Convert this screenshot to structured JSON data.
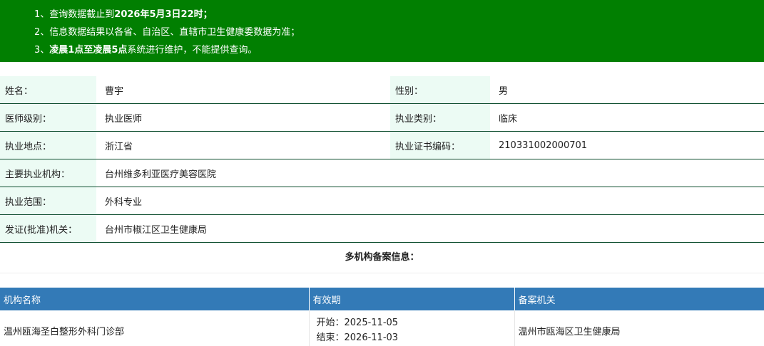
{
  "notice": {
    "line1_prefix": "1、查询数据截止到",
    "line1_bold": "2026年5月3日22时",
    "line1_suffix": "；",
    "line2": "2、信息数据结果以各省、自治区、直辖市卫生健康委数据为准；",
    "line3_prefix": "3、",
    "line3_bold": "凌晨1点至凌晨5点",
    "line3_suffix": "系统进行维护，不能提供查询。"
  },
  "colors": {
    "notice_bg": "#017f01",
    "label_bg": "#ecfbf4",
    "header_bg": "#337ab7",
    "row_border": "#0d4d2e"
  },
  "info": {
    "name_label": "姓名：",
    "name_value": "曹宇",
    "gender_label": "性别：",
    "gender_value": "男",
    "level_label": "医师级别：",
    "level_value": "执业医师",
    "category_label": "执业类别：",
    "category_value": "临床",
    "location_label": "执业地点：",
    "location_value": "浙江省",
    "cert_label": "执业证书编码：",
    "cert_value": "210331002000701",
    "institution_label": "主要执业机构：",
    "institution_value": "台州维多利亚医疗美容医院",
    "scope_label": "执业范围：",
    "scope_value": "外科专业",
    "authority_label": "发证(批准)机关：",
    "authority_value": "台州市椒江区卫生健康局"
  },
  "multi": {
    "title": "多机构备案信息：",
    "headers": [
      "机构名称",
      "有效期",
      "备案机关"
    ],
    "rows": [
      {
        "name": "温州瓯海圣白整形外科门诊部",
        "start": "开始：2025-11-05",
        "end": "结束：2026-11-03",
        "authority": "温州市瓯海区卫生健康局"
      }
    ]
  }
}
